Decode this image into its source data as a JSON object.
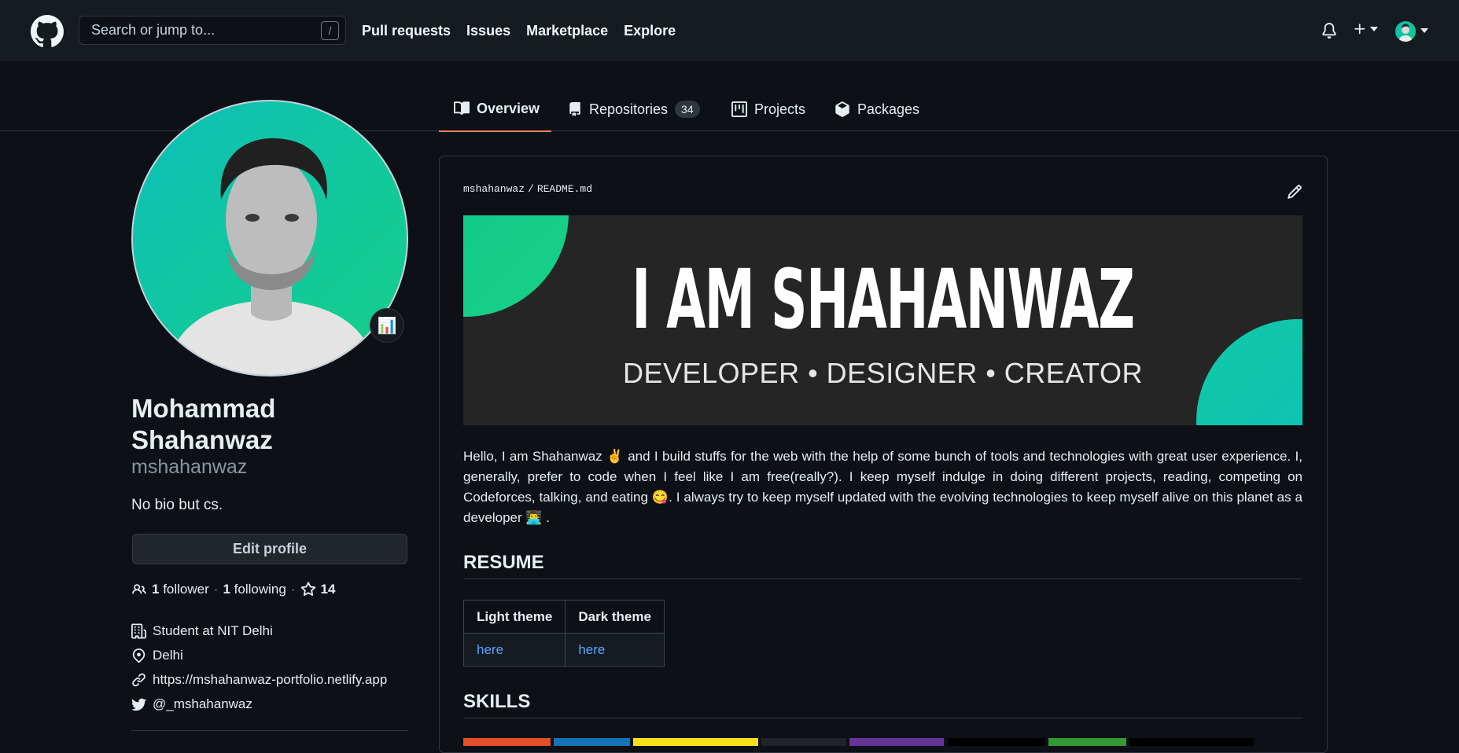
{
  "header": {
    "search_placeholder": "Search or jump to...",
    "search_shortcut": "/",
    "nav": [
      "Pull requests",
      "Issues",
      "Marketplace",
      "Explore"
    ]
  },
  "tabs": {
    "overview": "Overview",
    "repositories": "Repositories",
    "repositories_count": "34",
    "projects": "Projects",
    "packages": "Packages"
  },
  "profile": {
    "name": "Mohammad Shahanwaz",
    "login": "mshahanwaz",
    "bio": "No bio but cs.",
    "status_emoji": "📊",
    "edit_label": "Edit profile",
    "followers_count": "1",
    "followers_label": "follower",
    "following_count": "1",
    "following_label": "following",
    "stars_count": "14",
    "separator": "·",
    "company": "Student at NIT Delhi",
    "location": "Delhi",
    "website": "https://mshahanwaz-portfolio.netlify.app",
    "twitter": "@_mshahanwaz"
  },
  "readme": {
    "owner": "mshahanwaz",
    "slash": "/",
    "file": "README.md",
    "banner_title": "I AM SHAHANWAZ",
    "banner_subtitle": "DEVELOPER • DESIGNER • CREATOR",
    "intro": "Hello, I am Shahanwaz ✌️ and I build stuffs for the web with the help of some bunch of tools and technologies with great user experience. I, generally, prefer to code when I feel like I am free(really?). I keep myself indulge in doing different projects, reading, competing on Codeforces, talking, and eating 😋. I always try to keep myself updated with the evolving technologies to keep myself alive on this planet as a developer 👨‍💻 .",
    "resume_heading": "RESUME",
    "resume_table": {
      "headers": [
        "Light theme",
        "Dark theme"
      ],
      "links": [
        "here",
        "here"
      ]
    },
    "skills_heading": "SKILLS",
    "skill_badge_colors": [
      "#e34f26",
      "#1572b6",
      "#f7df1e",
      "#20232a",
      "#663399",
      "#000000",
      "#339933",
      "#000000"
    ]
  },
  "colors": {
    "header_bg": "#161b22",
    "page_bg": "#0d1117",
    "tab_underline": "#f78166",
    "link": "#58a6ff"
  }
}
